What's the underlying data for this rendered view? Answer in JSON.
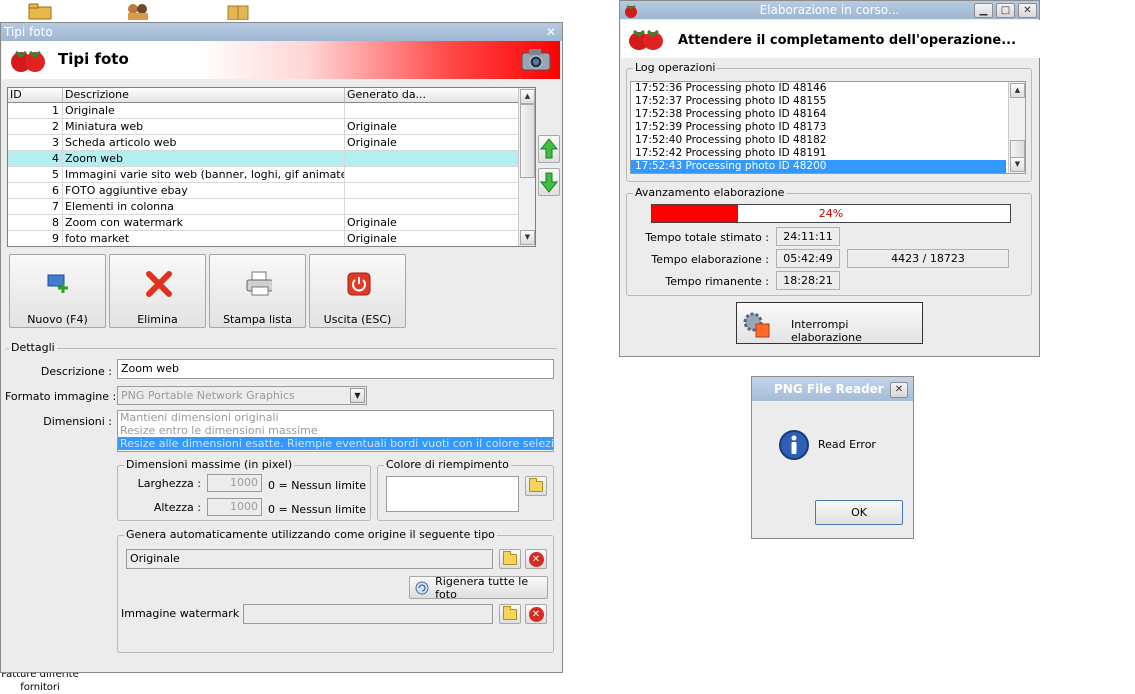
{
  "colors": {
    "accent_red": "#ff0000",
    "selection_blue": "#3399ff",
    "row_highlight": "#b3eef0",
    "title_bar": "#a9bfd9"
  },
  "desktop": {
    "icons": [
      "folder-icon",
      "people-icon",
      "package-icon"
    ],
    "bottom_label": "Fatture differite fornitori"
  },
  "tipi_window": {
    "title": "Tipi foto",
    "banner_title": "Tipi foto",
    "grid": {
      "columns": [
        "ID",
        "Descrizione",
        "Generato da..."
      ],
      "rows": [
        {
          "id": "1",
          "descrizione": "Originale",
          "generato": ""
        },
        {
          "id": "2",
          "descrizione": "Miniatura web",
          "generato": "Originale"
        },
        {
          "id": "3",
          "descrizione": "Scheda articolo web",
          "generato": "Originale"
        },
        {
          "id": "4",
          "descrizione": "Zoom web",
          "generato": ""
        },
        {
          "id": "5",
          "descrizione": "Immagini varie sito web (banner, loghi, gif animate, fla...",
          "generato": ""
        },
        {
          "id": "6",
          "descrizione": "FOTO aggiuntive ebay",
          "generato": ""
        },
        {
          "id": "7",
          "descrizione": "Elementi in colonna",
          "generato": ""
        },
        {
          "id": "8",
          "descrizione": "Zoom con watermark",
          "generato": "Originale"
        },
        {
          "id": "9",
          "descrizione": "foto market",
          "generato": "Originale"
        }
      ],
      "selected_row": 3
    },
    "buttons": {
      "nuovo": "Nuovo (F4)",
      "elimina": "Elimina",
      "stampa": "Stampa lista",
      "uscita": "Uscita (ESC)"
    },
    "dettagli": {
      "group_label": "Dettagli",
      "descrizione_label": "Descrizione :",
      "descrizione_value": "Zoom web",
      "formato_label": "Formato immagine :",
      "formato_value": "PNG Portable Network Graphics",
      "dimensioni_label": "Dimensioni :",
      "dimensioni_options": [
        "Mantieni dimensioni originali",
        "Resize entro le dimensioni massime",
        "Resize alle dimensioni esatte. Riempie eventuali bordi vuoti con il colore selezionato"
      ],
      "dimensioni_selected": 2,
      "dim_max_label": "Dimensioni massime (in pixel)",
      "larghezza_label": "Larghezza :",
      "larghezza_value": "1000",
      "larghezza_hint": "0 = Nessun limite",
      "altezza_label": "Altezza :",
      "altezza_value": "1000",
      "altezza_hint": "0 = Nessun limite",
      "colore_label": "Colore di riempimento",
      "genera_label": "Genera automaticamente utilizzando come origine il seguente tipo",
      "origine_value": "Originale",
      "rigenera_label": "Rigenera tutte le foto",
      "watermark_label": "Immagine watermark :",
      "watermark_value": ""
    }
  },
  "elab_window": {
    "title": "Elaborazione in corso...",
    "heading": "Attendere il completamento dell'operazione...",
    "log_label": "Log operazioni",
    "log_lines": [
      "17:52:36 Processing photo ID 48146",
      "17:52:37 Processing photo ID 48155",
      "17:52:38 Processing photo ID 48164",
      "17:52:39 Processing photo ID 48173",
      "17:52:40 Processing photo ID 48182",
      "17:52:42 Processing photo ID 48191",
      "17:52:43 Processing photo ID 48200"
    ],
    "progress_label": "Avanzamento elaborazione",
    "progress_percent": 24,
    "progress_text": "24%",
    "tempo_totale_label": "Tempo totale stimato :",
    "tempo_totale_value": "24:11:11",
    "tempo_elab_label": "Tempo elaborazione :",
    "tempo_elab_value": "05:42:49",
    "count_value": "4423 / 18723",
    "tempo_rimanente_label": "Tempo rimanente :",
    "tempo_rimanente_value": "18:28:21",
    "stop_button": "Interrompi elaborazione"
  },
  "png_dialog": {
    "title": "PNG File Reader",
    "message": "Read Error",
    "ok": "OK"
  }
}
